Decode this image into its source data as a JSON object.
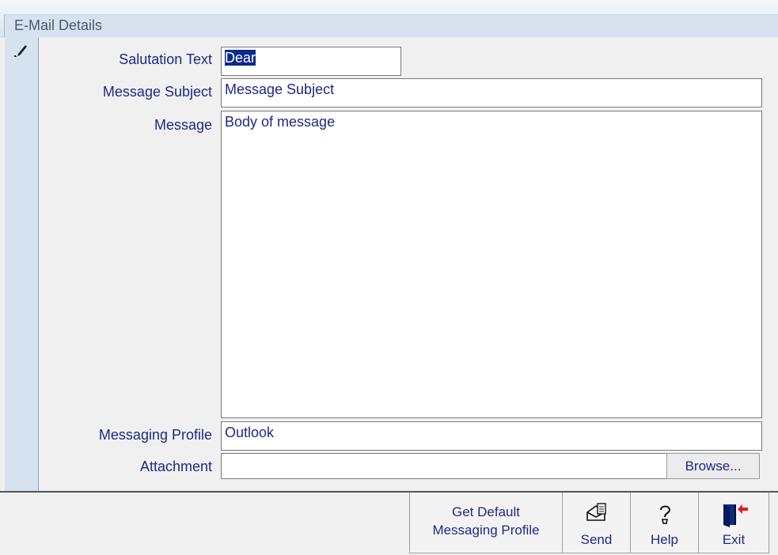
{
  "form": {
    "title": "E-Mail Details"
  },
  "fields": {
    "salutation": {
      "label": "Salutation Text",
      "value": "Dear"
    },
    "subject": {
      "label": "Message Subject",
      "value": "Message Subject"
    },
    "message": {
      "label": "Message",
      "value": "Body of message"
    },
    "profile": {
      "label": "Messaging Profile",
      "value": "Outlook"
    },
    "attachment": {
      "label": "Attachment",
      "value": "",
      "browse_label": "Browse..."
    }
  },
  "buttons": {
    "default_profile_line1": "Get Default",
    "default_profile_line2": "Messaging Profile",
    "send": "Send",
    "help": "Help",
    "exit": "Exit"
  },
  "icons": [
    "pencil-icon",
    "send-icon",
    "help-icon",
    "exit-icon"
  ],
  "colors": {
    "label_text": "#1c2a85",
    "selection": "#0a2a8c",
    "record_selector": "#d6e2ef"
  }
}
